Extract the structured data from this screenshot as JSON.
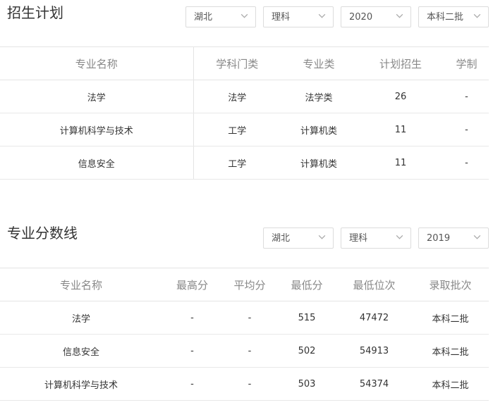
{
  "plan": {
    "title": "招生计划",
    "filters": [
      "湖北",
      "理科",
      "2020",
      "本科二批"
    ],
    "columns": [
      "专业名称",
      "学科门类",
      "专业类",
      "计划招生",
      "学制"
    ],
    "rows": [
      [
        "法学",
        "法学",
        "法学类",
        "26",
        "-"
      ],
      [
        "计算机科学与技术",
        "工学",
        "计算机类",
        "11",
        "-"
      ],
      [
        "信息安全",
        "工学",
        "计算机类",
        "11",
        "-"
      ]
    ]
  },
  "scores": {
    "title": "专业分数线",
    "filters": [
      "湖北",
      "理科",
      "2019"
    ],
    "columns": [
      "专业名称",
      "最高分",
      "平均分",
      "最低分",
      "最低位次",
      "录取批次"
    ],
    "rows": [
      [
        "法学",
        "-",
        "-",
        "515",
        "47472",
        "本科二批"
      ],
      [
        "信息安全",
        "-",
        "-",
        "502",
        "54913",
        "本科二批"
      ],
      [
        "计算机科学与技术",
        "-",
        "-",
        "503",
        "54374",
        "本科二批"
      ]
    ]
  }
}
